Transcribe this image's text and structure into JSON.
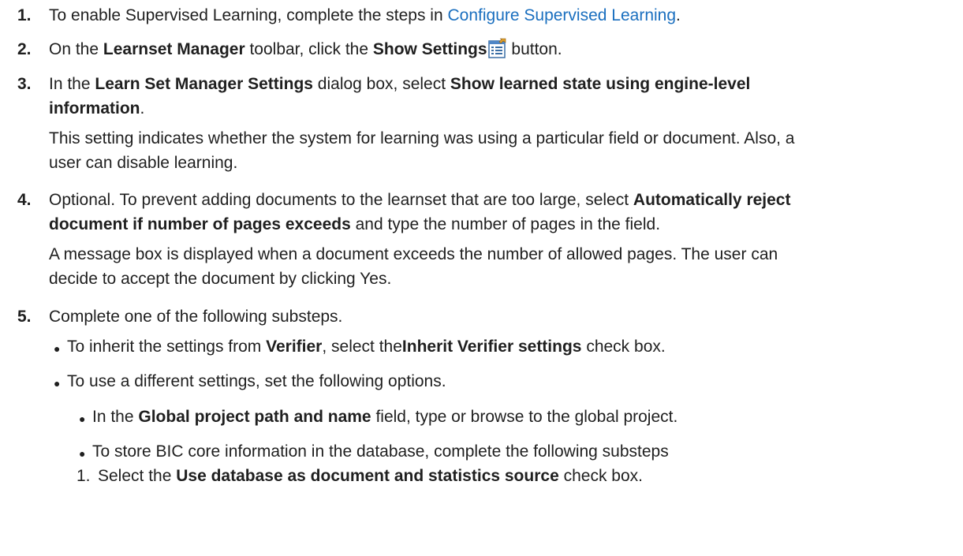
{
  "steps": [
    {
      "number": "1.",
      "text_before": "To enable Supervised Learning, complete the steps in ",
      "link": "Configure Supervised Learning",
      "text_after": "."
    },
    {
      "number": "2.",
      "t1": "On the ",
      "b1": "Learnset Manager",
      "t2": " toolbar, click the ",
      "b2": "Show Settings",
      "icon": "show-settings-icon",
      "t3": " button."
    },
    {
      "number": "3.",
      "t1": "In the ",
      "b1": "Learn Set Manager Settings",
      "t2": " dialog box, select ",
      "b2_line1": "Show learned state using engine-level",
      "b2_line2": "information",
      "t3": ".",
      "note_line1": "This setting indicates whether the system for learning was using a particular field or document. Also, a",
      "note_line2": "user can disable learning."
    },
    {
      "number": "4.",
      "t1": "Optional. To prevent adding documents to the learnset that are too large, select ",
      "b1_line1": "Automatically reject",
      "b1_line2": "document if number of pages exceeds",
      "t2": " and type the number of pages in the field.",
      "note_line1": "A message box is displayed when a document exceeds the number of allowed pages. The user can",
      "note_line2": "decide to accept the document by clicking Yes."
    },
    {
      "number": "5.",
      "text": "Complete one of the following substeps.",
      "bullets": [
        {
          "t1": "To inherit the settings from ",
          "b1": "Verifier",
          "t2": ", select the",
          "b2": "Inherit Verifier settings",
          "t3": " check box."
        },
        {
          "text": "To use a different settings, set the following options."
        }
      ],
      "sub_bullets": [
        {
          "t1": "In the ",
          "b1": "Global project path and name",
          "t2": " field, type or browse to the global project."
        },
        {
          "text": "To store BIC core information in the database, complete the following substeps"
        }
      ],
      "sub_sub_steps": [
        {
          "number": "1.",
          "t1": "Select the ",
          "b1": "Use database as document and statistics source",
          "t2": " check box."
        }
      ]
    }
  ],
  "bullet_glyph": "●"
}
